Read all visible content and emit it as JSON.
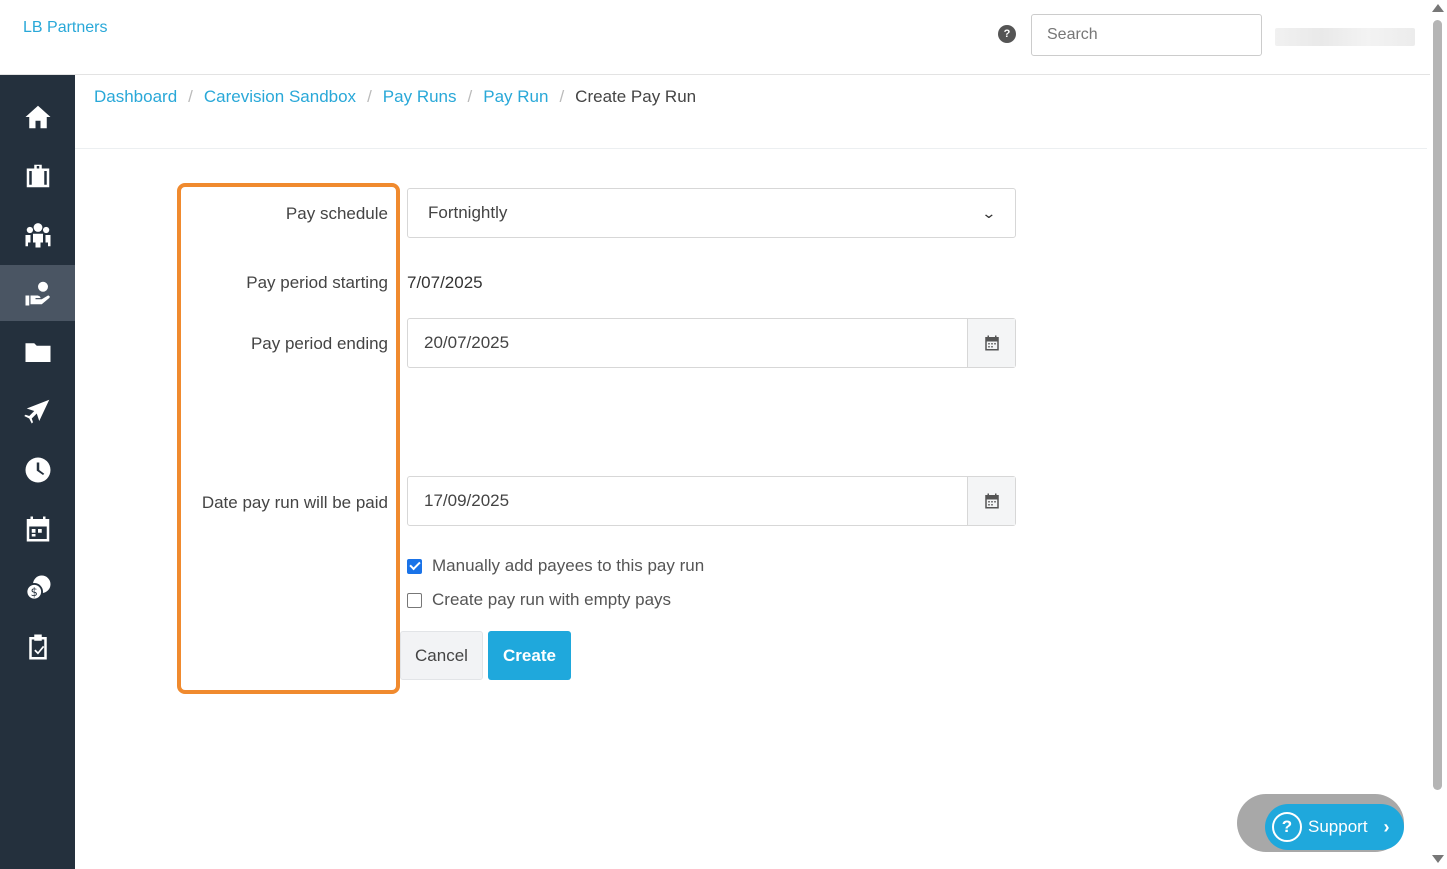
{
  "header": {
    "brand": "LB Partners",
    "help_icon": "?",
    "search_placeholder": "Search"
  },
  "sidebar": {
    "items": [
      {
        "icon": "home-icon",
        "active": false
      },
      {
        "icon": "briefcase-icon",
        "active": false
      },
      {
        "icon": "people-icon",
        "active": false
      },
      {
        "icon": "payroll-hand-icon",
        "active": true
      },
      {
        "icon": "folder-icon",
        "active": false
      },
      {
        "icon": "plane-icon",
        "active": false
      },
      {
        "icon": "clock-icon",
        "active": false
      },
      {
        "icon": "calendar-icon",
        "active": false
      },
      {
        "icon": "coins-icon",
        "active": false
      },
      {
        "icon": "clipboard-check-icon",
        "active": false
      }
    ]
  },
  "breadcrumb": {
    "items": [
      "Dashboard",
      "Carevision Sandbox",
      "Pay Runs",
      "Pay Run"
    ],
    "current": "Create Pay Run",
    "separator": "/"
  },
  "form": {
    "pay_schedule_label": "Pay schedule",
    "pay_schedule_value": "Fortnightly",
    "pay_period_starting_label": "Pay period starting",
    "pay_period_starting_value": "7/07/2025",
    "pay_period_ending_label": "Pay period ending",
    "pay_period_ending_value": "20/07/2025",
    "date_paid_label": "Date pay run will be paid",
    "date_paid_value": "17/09/2025",
    "manually_add_label": "Manually add payees to this pay run",
    "manually_add_checked": true,
    "empty_pays_label": "Create pay run with empty pays",
    "empty_pays_checked": false,
    "cancel_label": "Cancel",
    "create_label": "Create"
  },
  "support": {
    "label": "Support",
    "icon": "?",
    "chevron": "›"
  },
  "colors": {
    "accent": "#29a8d8",
    "button_primary": "#1fa8dc",
    "sidebar_bg": "#24303d",
    "highlight": "#f08a2e"
  }
}
